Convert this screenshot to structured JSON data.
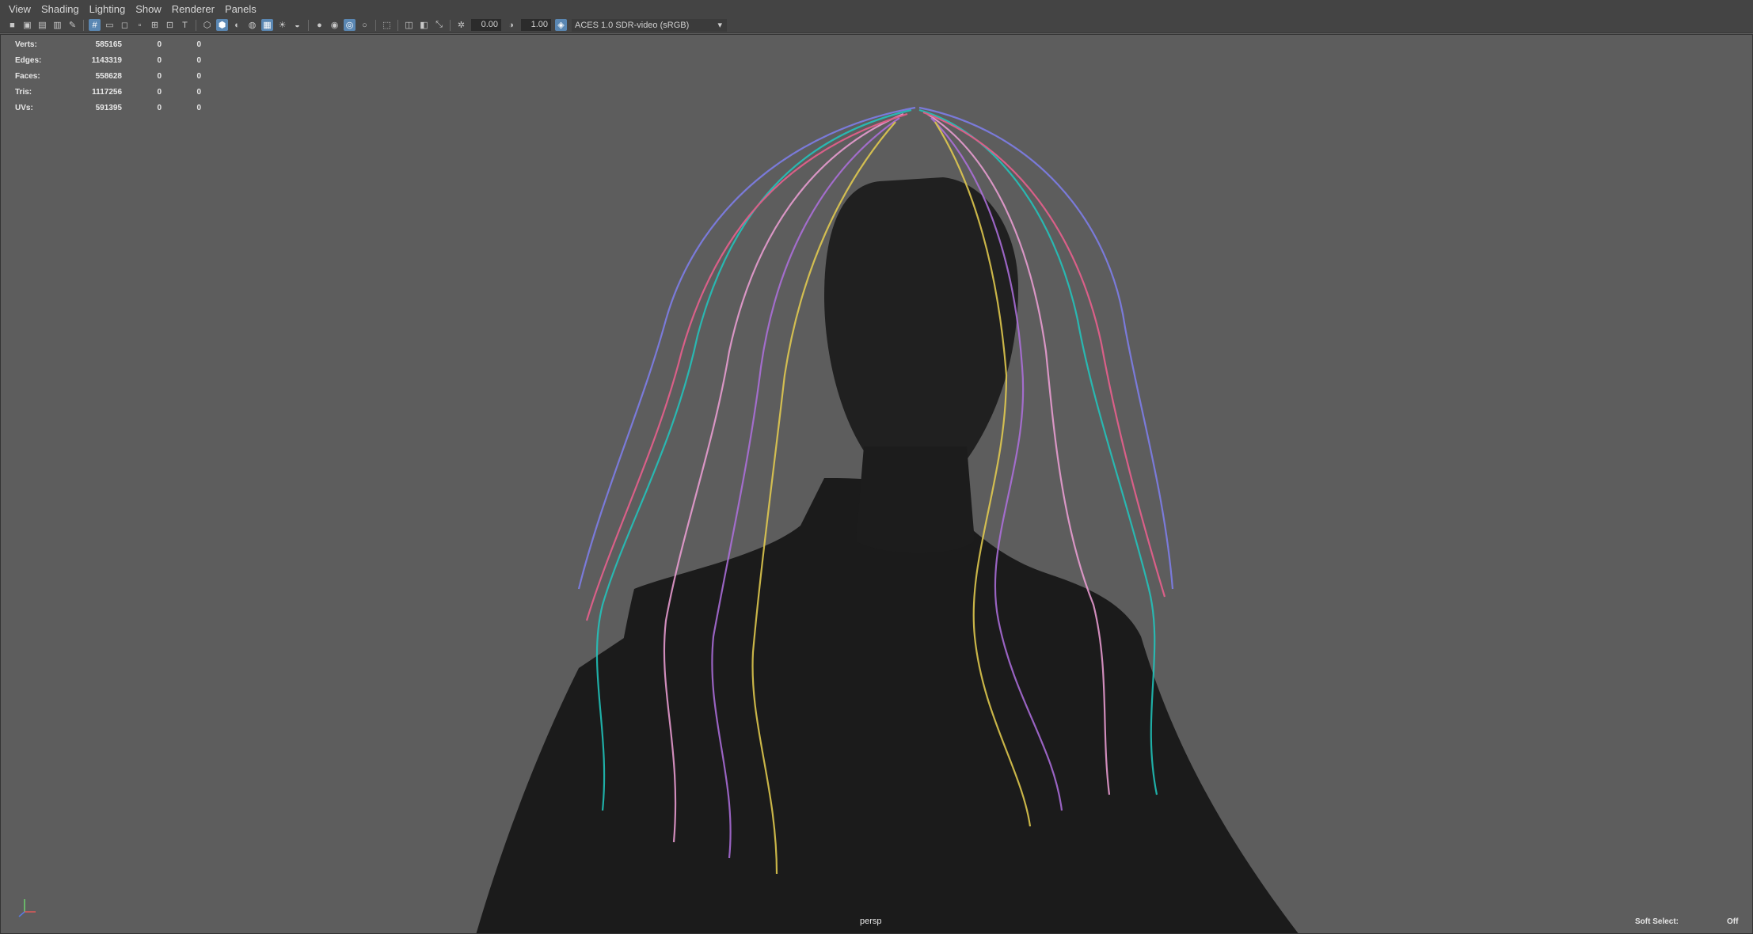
{
  "menubar": {
    "items": [
      "View",
      "Shading",
      "Lighting",
      "Show",
      "Renderer",
      "Panels"
    ]
  },
  "toolbar": {
    "field_a": "0.00",
    "field_b": "1.00",
    "color_space": "ACES 1.0 SDR-video (sRGB)"
  },
  "hud": {
    "rows": [
      {
        "label": "Verts:",
        "a": "585165",
        "b": "0",
        "c": "0"
      },
      {
        "label": "Edges:",
        "a": "1143319",
        "b": "0",
        "c": "0"
      },
      {
        "label": "Faces:",
        "a": "558628",
        "b": "0",
        "c": "0"
      },
      {
        "label": "Tris:",
        "a": "1117256",
        "b": "0",
        "c": "0"
      },
      {
        "label": "UVs:",
        "a": "591395",
        "b": "0",
        "c": "0"
      }
    ]
  },
  "viewport": {
    "camera": "persp",
    "soft_select_label": "Soft Select:",
    "soft_select_value": "Off"
  },
  "colors": {
    "background": "#5d5d5d",
    "body": "#1b1b1b",
    "hair": [
      "#20c9c0",
      "#f0a0d8",
      "#b070e0",
      "#e8d050",
      "#f06090",
      "#8080f0"
    ]
  }
}
